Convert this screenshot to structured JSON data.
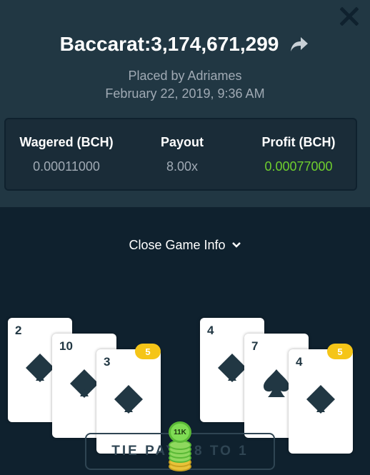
{
  "header": {
    "title": "Baccarat:3,174,671,299",
    "placed_by": "Placed by Adriames",
    "date": "February 22, 2019, 9:36 AM"
  },
  "stats": {
    "wagered": {
      "label": "Wagered (BCH)",
      "value": "0.00011000"
    },
    "payout": {
      "label": "Payout",
      "value": "8.00x"
    },
    "profit": {
      "label": "Profit (BCH)",
      "value": "0.00077000"
    }
  },
  "toggle": {
    "label": "Close Game Info"
  },
  "player_hand": {
    "cards": [
      {
        "rank": "2",
        "suit": "diamond"
      },
      {
        "rank": "10",
        "suit": "diamond"
      },
      {
        "rank": "3",
        "suit": "diamond"
      }
    ],
    "score": "5"
  },
  "banker_hand": {
    "cards": [
      {
        "rank": "4",
        "suit": "diamond"
      },
      {
        "rank": "7",
        "suit": "spade"
      },
      {
        "rank": "4",
        "suit": "diamond"
      }
    ],
    "score": "5"
  },
  "bet_area": {
    "label": "TIE PAYS 8 TO 1",
    "chip_value": "11K"
  },
  "colors": {
    "modal_bg": "#213743",
    "page_bg": "#0f212e",
    "profit_green": "#6fcf2e",
    "badge_yellow": "#f5c518",
    "chip_green": "#7fdc54"
  }
}
